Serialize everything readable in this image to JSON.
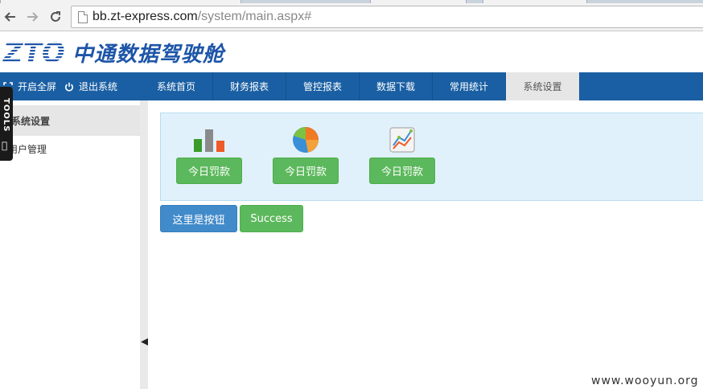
{
  "browser": {
    "url_host": "bb.zt-express.com",
    "url_path": "/system/main.aspx#"
  },
  "header": {
    "logo_text": "ZTO",
    "title": "中通数据驾驶舱"
  },
  "quick_actions": {
    "fullscreen": "开启全屏",
    "logout": "退出系统"
  },
  "nav": {
    "items": [
      {
        "label": "系统首页"
      },
      {
        "label": "财务报表"
      },
      {
        "label": "管控报表"
      },
      {
        "label": "数据下载"
      },
      {
        "label": "常用统计"
      },
      {
        "label": "系统设置",
        "active": true
      }
    ]
  },
  "sidebar": {
    "heading": "系统设置",
    "links": [
      {
        "label": "用户管理"
      }
    ]
  },
  "tools_tab": {
    "label": "TOOLS"
  },
  "tiles": [
    {
      "icon": "bar-chart-icon",
      "button": "今日罚款"
    },
    {
      "icon": "pie-chart-icon",
      "button": "今日罚款"
    },
    {
      "icon": "line-chart-icon",
      "button": "今日罚款"
    }
  ],
  "buttons": {
    "primary": "这里是按钮",
    "success": "Success"
  },
  "colors": {
    "nav_bg": "#1a5fa3",
    "brand_blue": "#1d55a8",
    "success": "#5cb85c",
    "primary": "#428bca",
    "panel_bg": "#e1f1fb"
  },
  "watermark": "www.wooyun.org"
}
